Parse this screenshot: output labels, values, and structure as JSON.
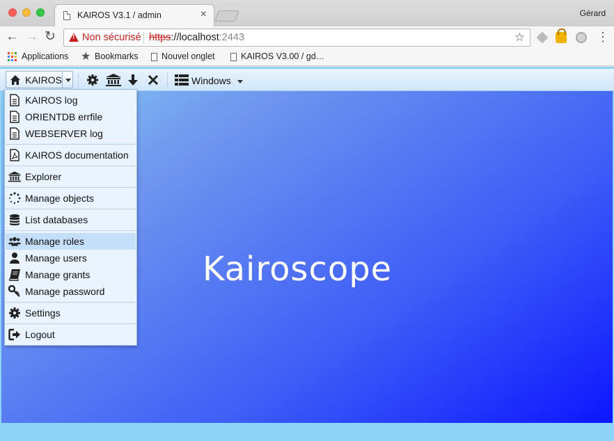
{
  "browser": {
    "tab_title": "KAIROS V3.1 / admin",
    "tab_close": "×",
    "user": "Gérard",
    "security_label": "Non sécurisé",
    "url": {
      "protocol": "https",
      "separator": "://",
      "host": "localhost",
      "port": ":2443"
    },
    "bookmarks": [
      {
        "label": "Applications",
        "icon": "apps-grid-icon"
      },
      {
        "label": "Bookmarks",
        "icon": "star-icon"
      },
      {
        "label": "Nouvel onglet",
        "icon": "page-icon"
      },
      {
        "label": "KAIROS V3.00 / gd…",
        "icon": "page-icon"
      }
    ]
  },
  "app": {
    "brand_label": "KAIROS",
    "windows_label": "Windows",
    "toolbar_icons": [
      "gear-icon",
      "bank-icon",
      "arrow-down-icon",
      "close-icon"
    ],
    "splash_text": "Kairoscope",
    "menu": {
      "active_index": 7,
      "items": [
        {
          "label": "KAIROS log",
          "icon": "file-text-icon"
        },
        {
          "label": "ORIENTDB errfile",
          "icon": "file-text-icon"
        },
        {
          "label": "WEBSERVER log",
          "icon": "file-text-icon"
        },
        {
          "label": "KAIROS documentation",
          "icon": "file-pdf-icon"
        },
        {
          "label": "Explorer",
          "icon": "bank-icon"
        },
        {
          "label": "Manage objects",
          "icon": "spinner-icon"
        },
        {
          "label": "List databases",
          "icon": "database-icon"
        },
        {
          "label": "Manage roles",
          "icon": "users-icon"
        },
        {
          "label": "Manage users",
          "icon": "user-icon"
        },
        {
          "label": "Manage grants",
          "icon": "book-icon"
        },
        {
          "label": "Manage password",
          "icon": "key-icon"
        },
        {
          "label": "Settings",
          "icon": "gear-icon"
        },
        {
          "label": "Logout",
          "icon": "sign-out-icon"
        }
      ]
    }
  },
  "colors": {
    "brand_accent": "#3d5df7",
    "menu_bg": "#eaf4fe",
    "menu_active": "#c6dff8",
    "insecure_red": "#c5221f"
  }
}
